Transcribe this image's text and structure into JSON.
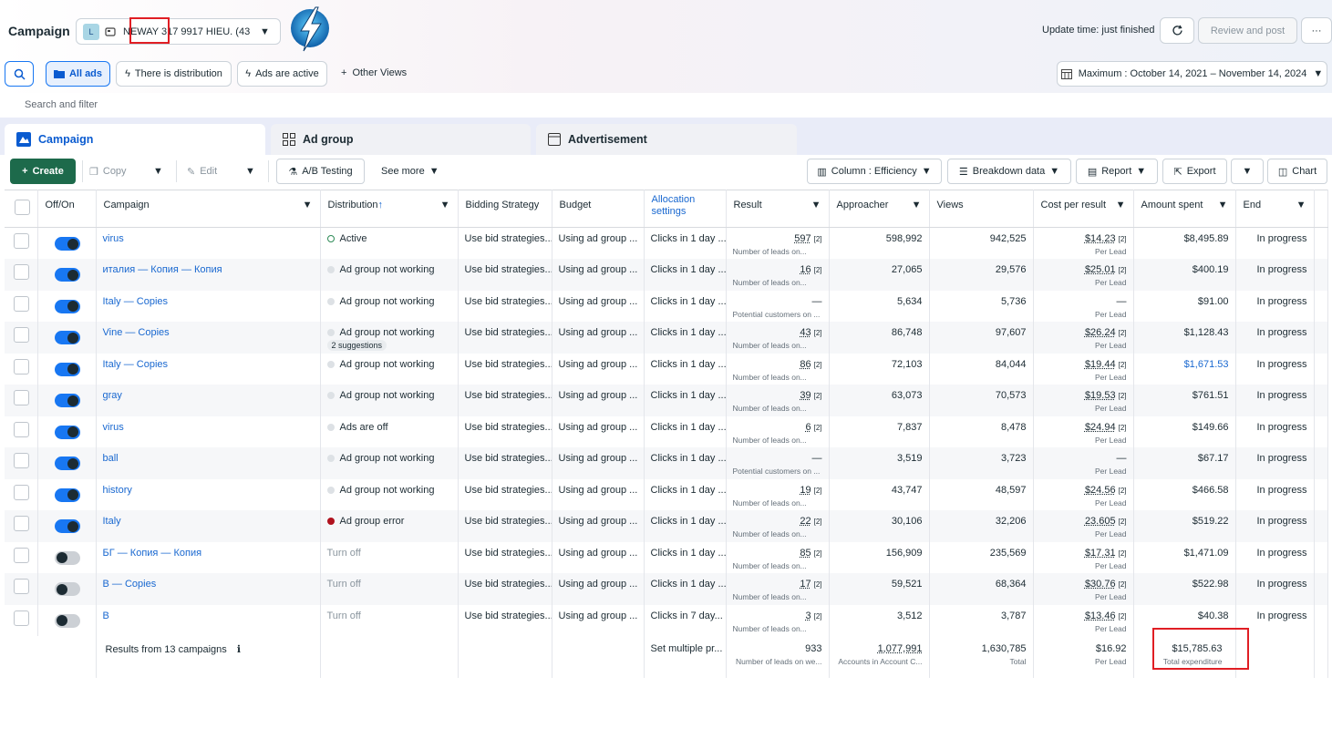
{
  "header": {
    "title": "Campaign",
    "account_badge": "L",
    "account_text": "NEWAY 317 9917 HIEU. (43...",
    "update_time": "Update time: just finished",
    "review_label": "Review and post",
    "more_label": "···"
  },
  "views": {
    "all_ads": "All ads",
    "distribution": "There is distribution",
    "ads_active": "Ads are active",
    "other_views": "Other Views",
    "date_range": "Maximum : October 14, 2021 – November 14, 2024"
  },
  "filter": {
    "placeholder": "Search and filter"
  },
  "tabs": [
    "Campaign",
    "Ad group",
    "Advertisement"
  ],
  "toolbar": {
    "create": "Create",
    "copy": "Copy",
    "edit": "Edit",
    "ab": "A/B Testing",
    "see_more": "See more",
    "columns": "Column : Efficiency",
    "breakdown": "Breakdown data",
    "report": "Report",
    "export": "Export",
    "chart": "Chart"
  },
  "columns": [
    "Off/On",
    "Campaign",
    "Distribution",
    "Bidding Strategy",
    "Budget",
    "Allocation settings",
    "Result",
    "Approacher",
    "Views",
    "Cost per result",
    "Amount spent",
    "End"
  ],
  "rows": [
    {
      "on": true,
      "name": "virus",
      "status": "Active",
      "dot": "active",
      "bid": "Use bid strategies...",
      "budget": "Using ad group ...",
      "alloc": "Clicks in 1 day ...",
      "result": "597",
      "result_sub": "Number of leads on...",
      "reach": "598,992",
      "views": "942,525",
      "cpr": "$14.23",
      "cpr_sub": "Per Lead",
      "spent": "$8,495.89",
      "end": "In progress"
    },
    {
      "on": true,
      "name": "италия — Копия — Копия",
      "status": "Ad group not working",
      "dot": "grey",
      "bid": "Use bid strategies...",
      "budget": "Using ad group ...",
      "alloc": "Clicks in 1 day ...",
      "result": "16",
      "result_sub": "Number of leads on...",
      "reach": "27,065",
      "views": "29,576",
      "cpr": "$25.01",
      "cpr_sub": "Per Lead",
      "spent": "$400.19",
      "end": "In progress"
    },
    {
      "on": true,
      "name": "Italy — Copies",
      "status": "Ad group not working",
      "dot": "grey",
      "bid": "Use bid strategies...",
      "budget": "Using ad group ...",
      "alloc": "Clicks in 1 day ...",
      "result": "—",
      "result_sub": "Potential customers on ...",
      "reach": "5,634",
      "views": "5,736",
      "cpr": "—",
      "cpr_sub": "Per Lead",
      "spent": "$91.00",
      "end": "In progress"
    },
    {
      "on": true,
      "name": "Vine — Copies",
      "status": "Ad group not working",
      "dot": "grey",
      "sugg": "2 suggestions",
      "bid": "Use bid strategies...",
      "budget": "Using ad group ...",
      "alloc": "Clicks in 1 day ...",
      "result": "43",
      "result_sub": "Number of leads on...",
      "reach": "86,748",
      "views": "97,607",
      "cpr": "$26.24",
      "cpr_sub": "Per Lead",
      "spent": "$1,128.43",
      "end": "In progress"
    },
    {
      "on": true,
      "name": "Italy — Copies",
      "status": "Ad group not working",
      "dot": "grey",
      "bid": "Use bid strategies...",
      "budget": "Using ad group ...",
      "alloc": "Clicks in 1 day ...",
      "result": "86",
      "result_sub": "Number of leads on...",
      "reach": "72,103",
      "views": "84,044",
      "cpr": "$19.44",
      "cpr_sub": "Per Lead",
      "spent": "$1,671.53",
      "spent_link": true,
      "end": "In progress"
    },
    {
      "on": true,
      "name": "gray",
      "status": "Ad group not working",
      "dot": "grey",
      "bid": "Use bid strategies...",
      "budget": "Using ad group ...",
      "alloc": "Clicks in 1 day ...",
      "result": "39",
      "result_sub": "Number of leads on...",
      "reach": "63,073",
      "views": "70,573",
      "cpr": "$19.53",
      "cpr_sub": "Per Lead",
      "spent": "$761.51",
      "end": "In progress"
    },
    {
      "on": true,
      "name": "virus",
      "status": "Ads are off",
      "dot": "grey",
      "bid": "Use bid strategies...",
      "budget": "Using ad group ...",
      "alloc": "Clicks in 1 day ...",
      "result": "6",
      "result_sub": "Number of leads on...",
      "reach": "7,837",
      "views": "8,478",
      "cpr": "$24.94",
      "cpr_sub": "Per Lead",
      "spent": "$149.66",
      "end": "In progress"
    },
    {
      "on": true,
      "name": "ball",
      "status": "Ad group not working",
      "dot": "grey",
      "bid": "Use bid strategies...",
      "budget": "Using ad group ...",
      "alloc": "Clicks in 1 day ...",
      "result": "—",
      "result_sub": "Potential customers on ...",
      "reach": "3,519",
      "views": "3,723",
      "cpr": "—",
      "cpr_sub": "Per Lead",
      "spent": "$67.17",
      "end": "In progress"
    },
    {
      "on": true,
      "name": "history",
      "status": "Ad group not working",
      "dot": "grey",
      "bid": "Use bid strategies...",
      "budget": "Using ad group ...",
      "alloc": "Clicks in 1 day ...",
      "result": "19",
      "result_sub": "Number of leads on...",
      "reach": "43,747",
      "views": "48,597",
      "cpr": "$24.56",
      "cpr_sub": "Per Lead",
      "spent": "$466.58",
      "end": "In progress"
    },
    {
      "on": true,
      "name": "Italy",
      "status": "Ad group error",
      "dot": "error",
      "bid": "Use bid strategies...",
      "budget": "Using ad group ...",
      "alloc": "Clicks in 1 day ...",
      "result": "22",
      "result_sub": "Number of leads on...",
      "reach": "30,106",
      "views": "32,206",
      "cpr": "23.605",
      "cpr_sub": "Per Lead",
      "spent": "$519.22",
      "end": "In progress"
    },
    {
      "on": false,
      "name": "БГ — Копия — Копия",
      "status": "Turn off",
      "dot": "none",
      "bid": "Use bid strategies...",
      "budget": "Using ad group ...",
      "alloc": "Clicks in 1 day ...",
      "result": "85",
      "result_sub": "Number of leads on...",
      "reach": "156,909",
      "views": "235,569",
      "cpr": "$17.31",
      "cpr_sub": "Per Lead",
      "spent": "$1,471.09",
      "end": "In progress"
    },
    {
      "on": false,
      "name": "B — Copies",
      "status": "Turn off",
      "dot": "none",
      "bid": "Use bid strategies...",
      "budget": "Using ad group ...",
      "alloc": "Clicks in 1 day ...",
      "result": "17",
      "result_sub": "Number of leads on...",
      "reach": "59,521",
      "views": "68,364",
      "cpr": "$30.76",
      "cpr_sub": "Per Lead",
      "spent": "$522.98",
      "end": "In progress"
    },
    {
      "on": false,
      "name": "B",
      "status": "Turn off",
      "dot": "none",
      "bid": "Use bid strategies...",
      "budget": "Using ad group ...",
      "alloc": "Clicks in 7 day...",
      "result": "3",
      "result_sub": "Number of leads on...",
      "reach": "3,512",
      "views": "3,787",
      "cpr": "$13.46",
      "cpr_sub": "Per Lead",
      "spent": "$40.38",
      "end": "In progress"
    }
  ],
  "totals": {
    "label": "Results from 13 campaigns",
    "alloc": "Set multiple pr...",
    "result": "933",
    "result_sub": "Number of leads on we...",
    "reach": "1,077,991",
    "reach_sub": "Accounts in Account C...",
    "views": "1,630,785",
    "views_sub": "Total",
    "cpr": "$16.92",
    "cpr_sub": "Per Lead",
    "spent": "$15,785.63",
    "spent_sub": "Total expenditure"
  },
  "colors": {
    "accent": "#1877f2",
    "create": "#1d6a4b",
    "highlight": "#e01e24",
    "error_dot": "#b0121e"
  }
}
